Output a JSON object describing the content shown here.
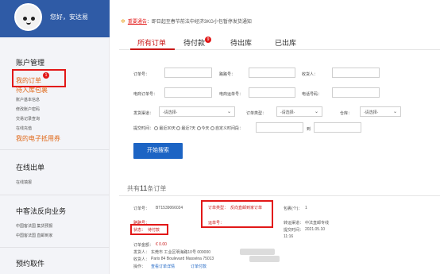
{
  "user": {
    "greeting": "您好，安达易"
  },
  "sidebar": {
    "account": {
      "title": "账户管理",
      "my_orders": "我的订单",
      "orders_badge": "1",
      "pending_packages": "待入库包裹",
      "links": [
        "账户基本信息",
        "修改账户密码",
        "交易记录查询",
        "在线充值"
      ],
      "ecard": "我的电子抵用券"
    },
    "online_shipping": {
      "title": "在线出单",
      "links": [
        "在线填报"
      ]
    },
    "china_law": {
      "title": "中客法反向业务",
      "links": [
        "中国客法国 集货预报",
        "中国客法国 直邮到家"
      ]
    },
    "booking": {
      "title": "预约取件"
    }
  },
  "notice": {
    "tag": "重要通告",
    "text": "：即日起至春节前法中经济3KG小包暂停发货通知"
  },
  "tabs": [
    {
      "label": "所有订单",
      "active": true
    },
    {
      "label": "待付款",
      "badge": "9"
    },
    {
      "label": "待出库"
    },
    {
      "label": "已出库"
    }
  ],
  "filters": {
    "order_no": "订单号：",
    "route_no": "路路号：",
    "receiver": "收货人：",
    "ec_order_no": "电商订单号：",
    "ec_waybill": "电商运单号：",
    "ec_phone": "电话号码：",
    "channel": "发货渠道：",
    "channel_value": "-请选择-",
    "order_type": "订单类型：",
    "order_type_value": "-请选择-",
    "warehouse": "仓库：",
    "warehouse_value": "-请选择-",
    "time_label": "提交时间：",
    "time_options": [
      "最近30天",
      "最近7天",
      "今天",
      "自定义时间段："
    ],
    "to": "到"
  },
  "search_button": "开始搜索",
  "summary": {
    "prefix": "共有",
    "count": "11",
    "suffix": "条订单"
  },
  "order": {
    "order_no_label": "订单号：",
    "order_no": "BT1539066024",
    "order_type_label": "订单类型：",
    "order_type": "反向直邮到家订单",
    "packages_label": "包裹(个)：",
    "packages": "1",
    "route_label": "路路号：",
    "waybill_label": "运单号：",
    "channel_label": "转运渠道：",
    "channel": "中法直邮专线",
    "status_label": "状态：",
    "status": "待付款",
    "submit_label": "提交时间：",
    "submit_date": "2021.05.10",
    "submit_time": "11:16",
    "amount_label": "订单金额：",
    "amount": "€ 0.00",
    "sender_label": "发货人：",
    "sender": "东莞市 工业区明海路10号 000000",
    "receiver_label": "收货人：",
    "receiver": "Paris  84 Boulevard Masséna  75013",
    "ops_label": "操作：",
    "op_detail": "查看订单详情",
    "op_pay": "订单付款"
  },
  "colors": {
    "brand_blue": "#2f5ba6",
    "accent_red": "#c81818",
    "orange": "#e06818",
    "button_blue": "#1c64c4"
  }
}
